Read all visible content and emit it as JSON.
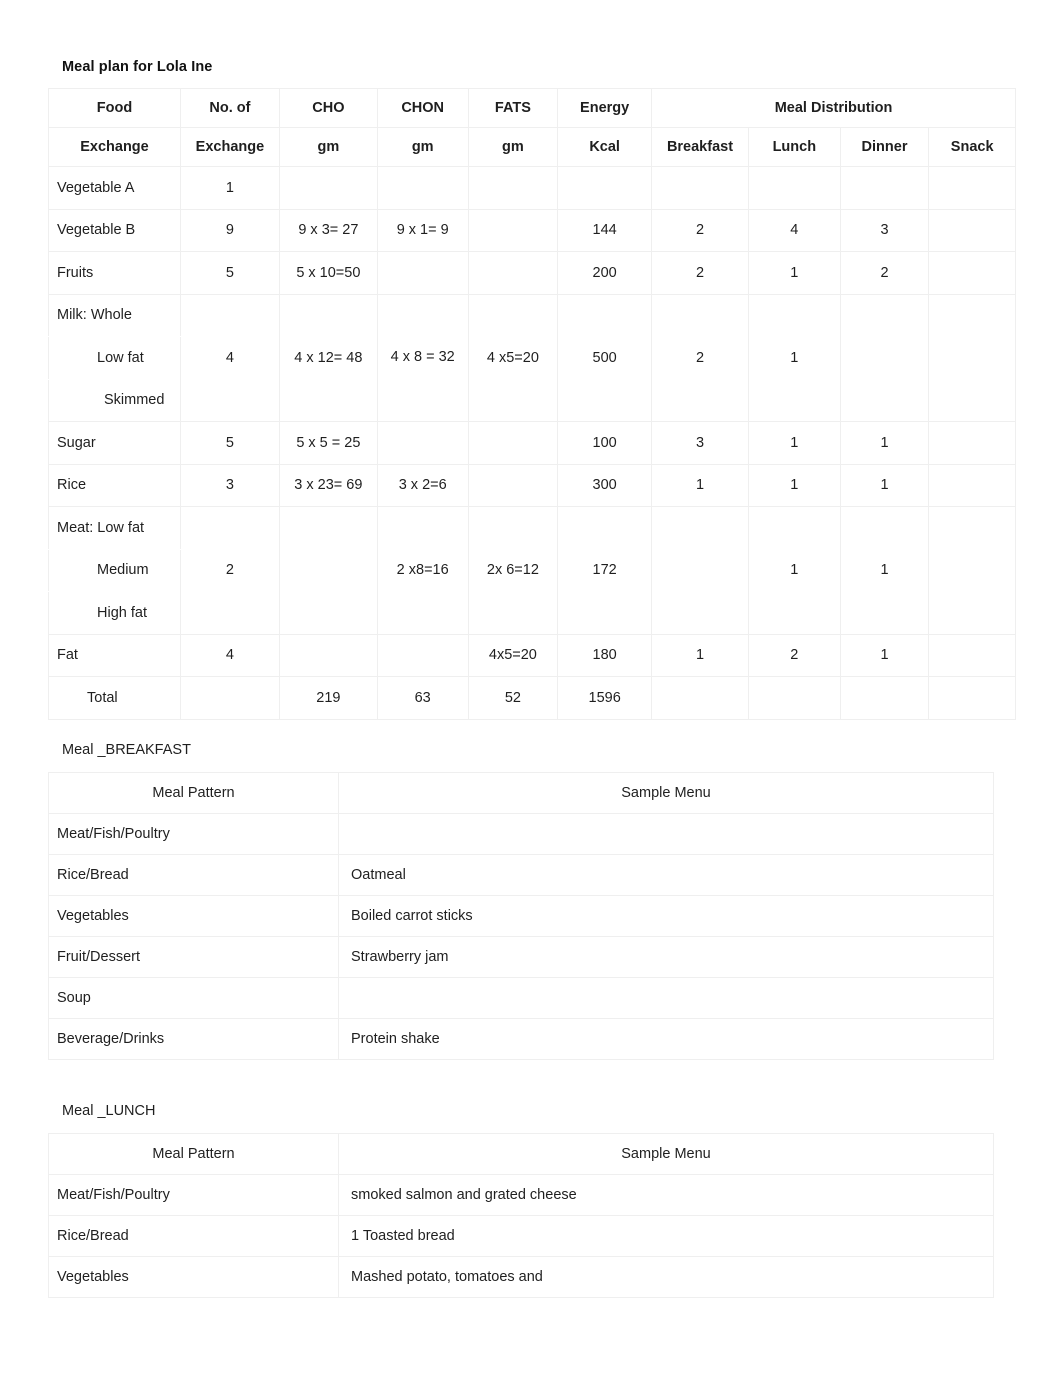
{
  "document": {
    "title": "Meal plan for Lola Ine"
  },
  "exchange_table": {
    "headers_row1": [
      "Food",
      "No. of",
      "CHO",
      "CHON",
      "FATS",
      "Energy",
      "Meal Distribution"
    ],
    "headers_row2": [
      "Exchange",
      "Exchange",
      "gm",
      "gm",
      "gm",
      "Kcal",
      "Breakfast",
      "Lunch",
      "Dinner",
      "Snack"
    ],
    "rows": [
      {
        "food": "Vegetable A",
        "exchange": "1",
        "cho": "",
        "chon": "",
        "fats": "",
        "energy": "",
        "breakfast": "",
        "lunch": "",
        "dinner": "",
        "snack": ""
      },
      {
        "food": "Vegetable B",
        "exchange": "9",
        "cho": "9 x 3= 27",
        "chon": "9 x 1= 9",
        "fats": "",
        "energy": "144",
        "breakfast": "2",
        "lunch": "4",
        "dinner": "3",
        "snack": ""
      },
      {
        "food": "Fruits",
        "exchange": "5",
        "cho": "5 x 10=50",
        "chon": "",
        "fats": "",
        "energy": "200",
        "breakfast": "2",
        "lunch": "1",
        "dinner": "2",
        "snack": ""
      },
      {
        "food": "Milk: Whole",
        "food_line2": "Low fat",
        "food_line3": "Skimmed",
        "exchange": "4",
        "cho": "4 x 12= 48",
        "chon": "4 x 8 = 32",
        "fats": "4 x5=20",
        "energy": "500",
        "breakfast": "2",
        "lunch": "1",
        "dinner": "",
        "snack": ""
      },
      {
        "food": "Sugar",
        "exchange": "5",
        "cho": "5 x 5 = 25",
        "chon": "",
        "fats": "",
        "energy": "100",
        "breakfast": "3",
        "lunch": "1",
        "dinner": "1",
        "snack": ""
      },
      {
        "food": "Rice",
        "exchange": "3",
        "cho": "3 x 23= 69",
        "chon": "3 x 2=6",
        "fats": "",
        "energy": "300",
        "breakfast": "1",
        "lunch": "1",
        "dinner": "1",
        "snack": ""
      },
      {
        "food": "Meat: Low fat",
        "food_line2": "Medium",
        "food_line3": "High fat",
        "exchange": "2",
        "cho": "",
        "chon": "2 x8=16",
        "fats": "2x 6=12",
        "energy": "172",
        "breakfast": "",
        "lunch": "1",
        "dinner": "1",
        "snack": ""
      },
      {
        "food": "Fat",
        "exchange": "4",
        "cho": "",
        "chon": "",
        "fats": "4x5=20",
        "energy": "180",
        "breakfast": "1",
        "lunch": "2",
        "dinner": "1",
        "snack": ""
      }
    ],
    "total_row": {
      "label": "Total",
      "exchange": "",
      "cho": "219",
      "chon": "63",
      "fats": "52",
      "energy": "1596",
      "breakfast": "",
      "lunch": "",
      "dinner": "",
      "snack": ""
    }
  },
  "breakfast": {
    "section_label": "Meal _BREAKFAST",
    "col_pattern": "Meal Pattern",
    "col_menu": "Sample Menu",
    "rows": [
      {
        "pattern": "Meat/Fish/Poultry",
        "menu": ""
      },
      {
        "pattern": "Rice/Bread",
        "menu": "Oatmeal"
      },
      {
        "pattern": "Vegetables",
        "menu": "Boiled carrot sticks"
      },
      {
        "pattern": "Fruit/Dessert",
        "menu": "Strawberry jam"
      },
      {
        "pattern": "Soup",
        "menu": ""
      },
      {
        "pattern": "Beverage/Drinks",
        "menu": "Protein shake"
      }
    ]
  },
  "lunch": {
    "section_label": "Meal _LUNCH",
    "col_pattern": "Meal Pattern",
    "col_menu": "Sample Menu",
    "rows": [
      {
        "pattern": "Meat/Fish/Poultry",
        "menu": "smoked salmon and grated cheese"
      },
      {
        "pattern": "Rice/Bread",
        "menu": "1 Toasted bread"
      },
      {
        "pattern": "Vegetables",
        "menu": "Mashed potato, tomatoes and"
      }
    ]
  }
}
